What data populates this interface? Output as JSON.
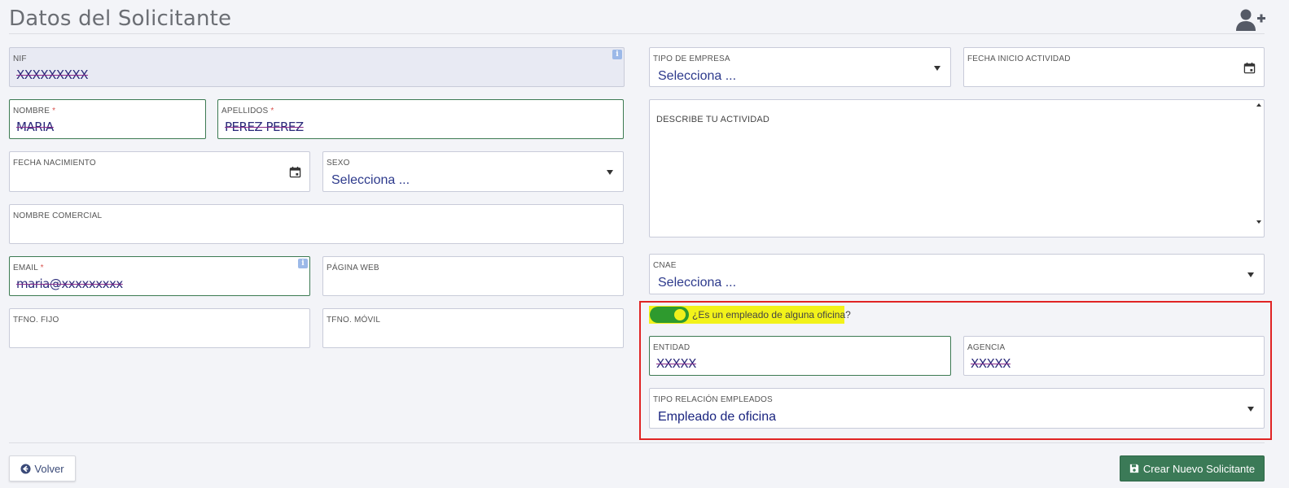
{
  "header": {
    "title": "Datos del Solicitante",
    "add_user_icon": "user-plus-icon"
  },
  "left": {
    "nif": {
      "label": "NIF",
      "value": "XXXXXXXXX"
    },
    "nombre": {
      "label": "NOMBRE",
      "required": "*",
      "value": "MARIA"
    },
    "apellidos": {
      "label": "APELLIDOS",
      "required": "*",
      "value": "PEREZ PEREZ"
    },
    "fecha_nacimiento": {
      "label": "FECHA NACIMIENTO"
    },
    "sexo": {
      "label": "SEXO",
      "placeholder": "Selecciona ..."
    },
    "nombre_comercial": {
      "label": "NOMBRE COMERCIAL"
    },
    "email": {
      "label": "EMAIL",
      "required": "*",
      "value": "maria@xxxxxxxxx"
    },
    "pagina_web": {
      "label": "PÁGINA WEB"
    },
    "tfno_fijo": {
      "label": "TFNO. FIJO"
    },
    "tfno_movil": {
      "label": "TFNO. MÓVIL"
    }
  },
  "right": {
    "tipo_empresa": {
      "label": "TIPO DE EMPRESA",
      "placeholder": "Selecciona ..."
    },
    "fecha_inicio": {
      "label": "FECHA INICIO ACTIVIDAD"
    },
    "describe": {
      "placeholder": "DESCRIBE TU ACTIVIDAD"
    },
    "cnae": {
      "label": "CNAE",
      "placeholder": "Selecciona ..."
    },
    "empleado_toggle": {
      "label": "¿Es un empleado de alguna oficina?",
      "checked": true
    },
    "entidad": {
      "label": "ENTIDAD",
      "value": "XXXXX"
    },
    "agencia": {
      "label": "AGENCIA",
      "value": "XXXXX"
    },
    "tipo_relacion": {
      "label": "TIPO RELACIÓN EMPLEADOS",
      "value": "Empleado de oficina"
    }
  },
  "footer": {
    "back_label": "Volver",
    "create_label": "Crear Nuevo Solicitante"
  },
  "colors": {
    "accent_green": "#3b7a57",
    "toggle_green": "#2e9a2e",
    "highlight_yellow": "#f2f21a",
    "red_outline": "#e02424",
    "select_text": "#1b2580"
  }
}
